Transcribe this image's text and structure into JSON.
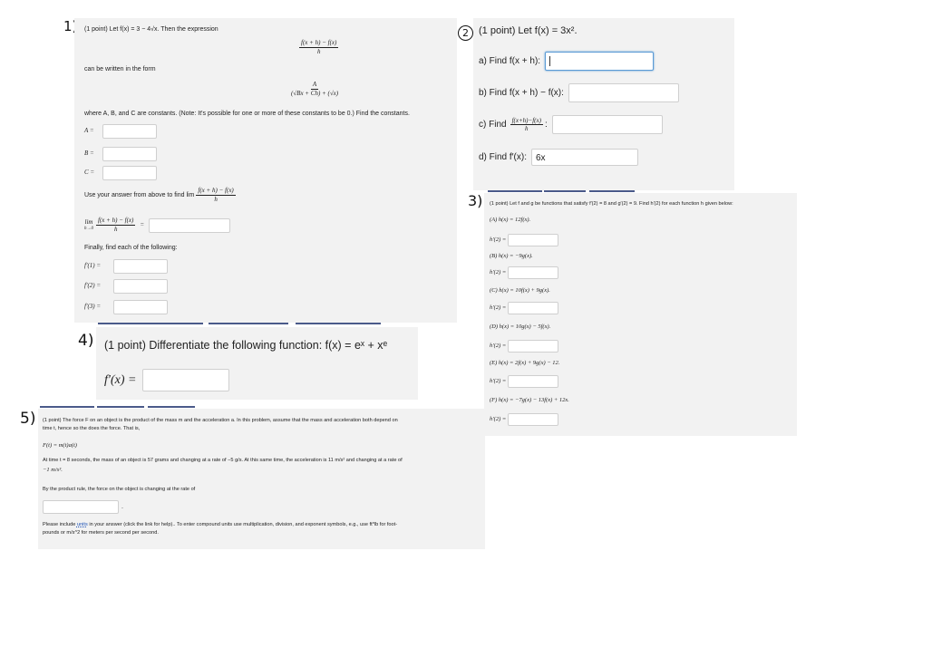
{
  "marks": {
    "p1": "1)",
    "p2": "2",
    "p3": "3)",
    "p4": "4)",
    "p5": "5)"
  },
  "p1": {
    "intro": "(1 point) Let f(x) = 3 − 4√x. Then the expression",
    "expr_num": "f(x + h) − f(x)",
    "expr_den": "h",
    "can_be": "can be written in the form",
    "form_num": "A",
    "form_den": "(√Bx + Ch) + (√x)",
    "where": "where A, B, and C are constants. (Note: It's possible for one or more of these constants to be 0.) Find the constants.",
    "a_label": "A =",
    "b_label": "B =",
    "c_label": "C =",
    "use_answer": "Use your answer from above to find lim",
    "lim_sub": "h→0",
    "lim_num": "f(x + h) − f(x)",
    "lim_den": "h",
    "lim_label": "lim",
    "eq": "=",
    "finally": "Finally, find each of the following:",
    "f1": "f′(1) =",
    "f2": "f′(2) =",
    "f3": "f′(3) ="
  },
  "p2": {
    "intro": "(1 point) Let f(x) = 3x².",
    "a": "a) Find f(x + h):",
    "b": "b) Find f(x + h) − f(x):",
    "c_pre": "c) Find",
    "c_num": "f(x+h)−f(x)",
    "c_den": "h",
    "c_post": ":",
    "d": "d) Find f′(x):",
    "d_value": "6x"
  },
  "p3": {
    "intro": "(1 point) Let f and g be functions that satisfy f′(2) = 8 and g′(2) = 9. Find h′(2) for each function h given below:",
    "items": [
      {
        "label": "(A) h(x) = 12f(x).",
        "ans": "h′(2) ="
      },
      {
        "label": "(B) h(x) = −9g(x).",
        "ans": "h′(2) ="
      },
      {
        "label": "(C) h(x) = 10f(x) + 9g(x).",
        "ans": "h′(2) ="
      },
      {
        "label": "(D) h(x) = 10g(x) − 5f(x).",
        "ans": "h′(2) ="
      },
      {
        "label": "(E) h(x) = 2f(x) + 9g(x) − 12.",
        "ans": "h′(2) ="
      },
      {
        "label": "(F) h(x) = −7g(x) − 13f(x) + 12x.",
        "ans": "h′(2) ="
      }
    ]
  },
  "p4": {
    "intro": "(1 point) Differentiate the following function: f(x) = eˣ + xᵉ",
    "ans_label": "f′(x) ="
  },
  "p5": {
    "line1": "(1 point) The force F on an object is the product of the mass m and the acceleration a. In this problem, assume that the mass and acceleration both depend on",
    "line2": "time t, hence so the does the force. That is,",
    "formula": "F(t) = m(t)a(t)",
    "line3": "At time t = 8 seconds, the mass of an object is 57 grams and changing at a rate of −5 g/s. At this same time, the acceleration is 11 m/s² and changing at a rate of",
    "line4": "−1 m/s³.",
    "line5": "By the product rule, the force on the object is changing at the rate of",
    "units_pre": "Please include ",
    "units_link": "units",
    "units_post": " in your answer (click the link for help).. To enter compound units use multiplication, division, and exponent symbols, e.g., use ft*lb for foot-",
    "line7": "pounds or m/s^2 for meters per second per second."
  }
}
